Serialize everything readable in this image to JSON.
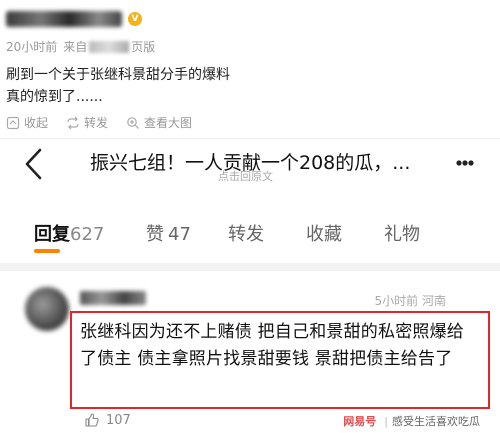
{
  "post": {
    "username": "阿鸡被删了",
    "vip_badge": "V",
    "time": "20小时前",
    "source_prefix": "来自",
    "source_suffix": "页版",
    "text_line1": "刷到一个关于张继科景甜分手的爆料",
    "text_line2": "真的惊到了......",
    "actions": [
      {
        "icon": "collapse-icon",
        "label": "收起"
      },
      {
        "icon": "repost-icon",
        "label": "转发"
      },
      {
        "icon": "zoom-in-icon",
        "label": "查看大图"
      }
    ]
  },
  "screenshot": {
    "title": "振兴七组！一人贡献一个208的瓜，...",
    "subtitle": "点击回原文",
    "tabs": [
      {
        "label": "回复",
        "count": "627",
        "active": true
      },
      {
        "label": "赞",
        "count": "47",
        "active": false
      },
      {
        "label": "转发",
        "count": "",
        "active": false
      },
      {
        "label": "收藏",
        "count": "",
        "active": false
      },
      {
        "label": "礼物",
        "count": "",
        "active": false
      }
    ],
    "comment": {
      "meta": "5小时前 河南",
      "text": "张继科因为还不上赌债 把自己和景甜的私密照爆给了债主 债主拿照片找景甜要钱 景甜把债主给告了",
      "likes": "107"
    },
    "watermark": {
      "logo": "网易号",
      "account": "感受生活喜欢吃瓜"
    }
  },
  "colors": {
    "accent": "#ff8200",
    "highlight_border": "#e0262b",
    "muted_text": "#999999"
  }
}
